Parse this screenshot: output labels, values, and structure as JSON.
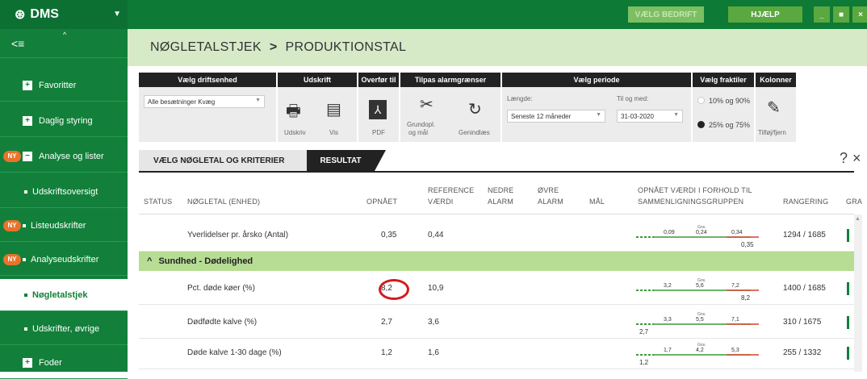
{
  "app": {
    "logo": "DMS",
    "caret": "▼"
  },
  "topbar": {
    "vaelg_bedrift": "VÆLG BEDRIFT",
    "hjaelp": "HJÆLP",
    "minimize": "_",
    "restore": "■",
    "close": "×"
  },
  "sidebar": {
    "collapse": "<≡",
    "items": [
      {
        "label": "Favoritter",
        "ny": false,
        "kind": "plus"
      },
      {
        "label": "Daglig styring",
        "ny": false,
        "kind": "plus"
      },
      {
        "label": "Analyse og lister",
        "ny": true,
        "kind": "minus"
      },
      {
        "label": "Udskriftsoversigt",
        "ny": false,
        "kind": "dot"
      },
      {
        "label": "Listeudskrifter",
        "ny": true,
        "kind": "dot"
      },
      {
        "label": "Analyseudskrifter",
        "ny": true,
        "kind": "dot"
      },
      {
        "label": "Nøgletalstjek",
        "ny": false,
        "kind": "dot",
        "active": true
      },
      {
        "label": "Udskrifter, øvrige",
        "ny": false,
        "kind": "dot"
      },
      {
        "label": "Foder",
        "ny": false,
        "kind": "plus"
      }
    ],
    "ny_label": "NY"
  },
  "breadcrumb": {
    "part1": "NØGLETALSTJEK",
    "sep": ">",
    "part2": "PRODUKTIONSTAL"
  },
  "toolbar": {
    "driftsenhed": {
      "header": "Vælg driftsenhed",
      "value": "Alle besætninger Kvæg"
    },
    "udskrift": {
      "header": "Udskrift",
      "udskriv": "Udskriv",
      "vis": "Vis"
    },
    "overfoer": {
      "header": "Overfør til",
      "pdf": "PDF"
    },
    "alarm": {
      "header": "Tilpas alarmgrænser",
      "grundopl": "Grundopl.",
      "og_maal": "og mål",
      "genindlaes": "Genindlæs"
    },
    "periode": {
      "header": "Vælg periode",
      "laengde_label": "Længde:",
      "laengde_value": "Seneste 12 måneder",
      "til_label": "Til og med:",
      "til_value": "31-03-2020"
    },
    "fraktiler": {
      "header": "Vælg fraktiler",
      "opt1": "10% og 90%",
      "opt2": "25% og 75%"
    },
    "kolonner": {
      "header": "Kolonner",
      "tilfoej": "Tilføj/fjern"
    }
  },
  "tabs": {
    "tab1": "VÆLG NØGLETAL OG KRITERIER",
    "tab2": "RESULTAT"
  },
  "help": "?",
  "close_panel": "×",
  "columns": {
    "status": "STATUS",
    "noegletal": "NØGLETAL (ENHED)",
    "opnaaet": "OPNÅET",
    "ref1": "REFERENCE",
    "ref2": "VÆRDI",
    "nedre1": "NEDRE",
    "nedre2": "ALARM",
    "oevre1": "ØVRE",
    "oevre2": "ALARM",
    "maal": "MÅL",
    "forhold1": "OPNÅET VÆRDI I FORHOLD TIL",
    "forhold2": "SAMMENLIGNINGSGRUPPEN",
    "rangering": "RANGERING",
    "gra": "GRA"
  },
  "group_label": "Sundhed - Dødelighed",
  "group_caret": "^",
  "rows": [
    {
      "name": "Yverlidelser pr. årsko (Antal)",
      "opnaaet": "0,35",
      "ref": "0,44",
      "low": "0,09",
      "gns": "0,24",
      "high": "0,34",
      "val": "0,35",
      "rang": "1294 / 1685"
    },
    {
      "name": "Pct. døde køer (%)",
      "opnaaet": "8,2",
      "ref": "10,9",
      "low": "3,2",
      "gns": "5,6",
      "high": "7,2",
      "val": "8,2",
      "rang": "1400 / 1685",
      "circled": true
    },
    {
      "name": "Dødfødte kalve (%)",
      "opnaaet": "2,7",
      "ref": "3,6",
      "low": "3,3",
      "gns": "5,5",
      "high": "7,1",
      "val": "2,7",
      "rang": "310 / 1675"
    },
    {
      "name": "Døde kalve 1-30 dage (%)",
      "opnaaet": "1,2",
      "ref": "1,6",
      "low": "1,7",
      "gns": "4,2",
      "high": "5,3",
      "val": "1,2",
      "rang": "255 / 1332"
    }
  ],
  "gns_label": "Gns."
}
